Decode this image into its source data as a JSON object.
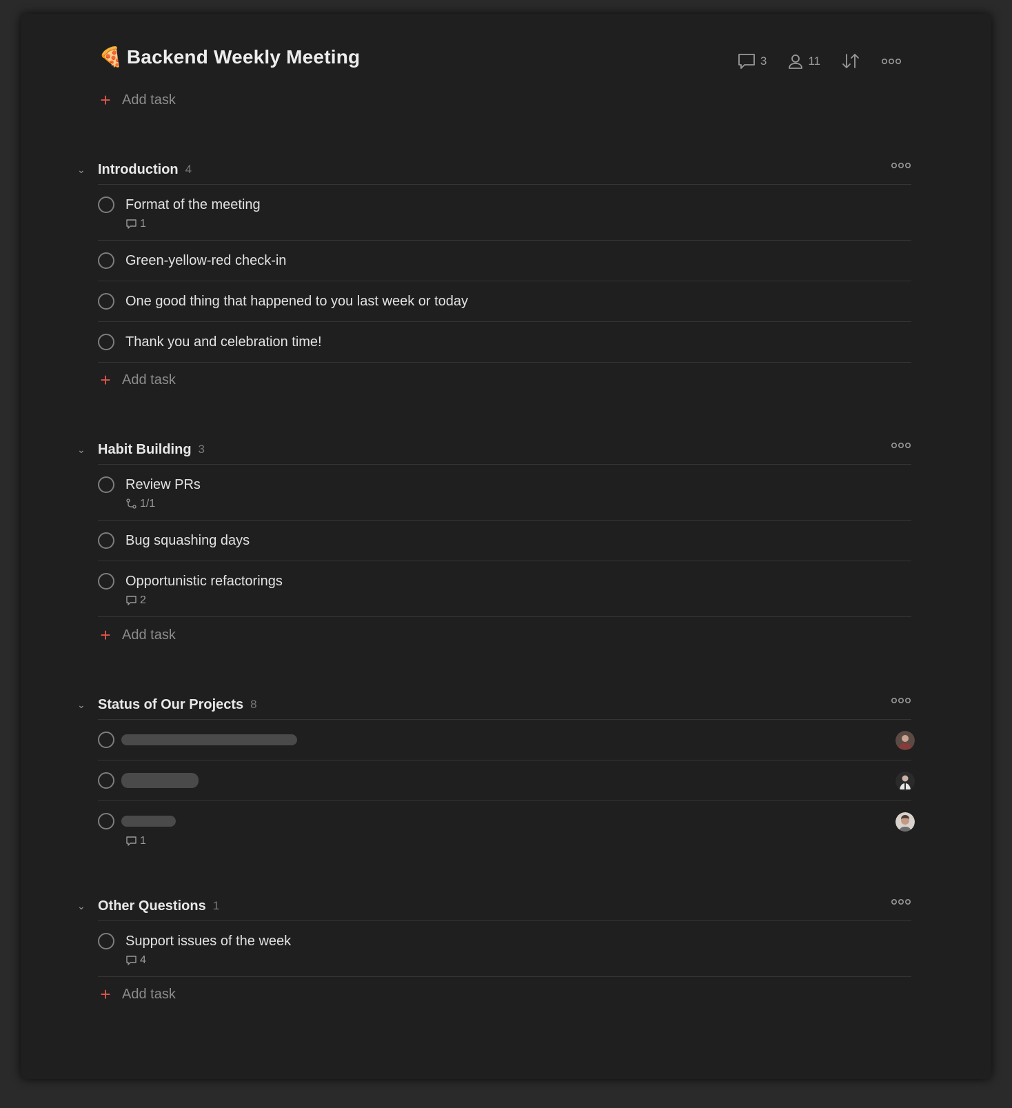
{
  "project": {
    "emoji": "🍕",
    "title": "Backend Weekly Meeting",
    "comments_count": "3",
    "members_count": "11"
  },
  "add_task_label": "Add task",
  "sections": [
    {
      "title": "Introduction",
      "count": "4",
      "tasks": [
        {
          "text": "Format of the meeting",
          "comments": "1"
        },
        {
          "text": "Green-yellow-red check-in"
        },
        {
          "text": "One good thing that happened to you last week or today"
        },
        {
          "text": "Thank you and celebration time!"
        }
      ]
    },
    {
      "title": "Habit Building",
      "count": "3",
      "tasks": [
        {
          "text": "Review PRs",
          "subtasks": "1/1"
        },
        {
          "text": "Bug squashing days"
        },
        {
          "text": "Opportunistic refactorings",
          "comments": "2"
        }
      ]
    },
    {
      "title": "Status of Our Projects",
      "count": "8",
      "tasks": [
        {
          "redacted": true
        },
        {
          "redacted": true
        },
        {
          "redacted": true,
          "comments": "1"
        }
      ]
    },
    {
      "title": "Other Questions",
      "count": "1",
      "tasks": [
        {
          "text": "Support issues of the week",
          "comments": "4"
        }
      ]
    }
  ],
  "colors": {
    "background": "#1f1f1f",
    "accent_plus": "#e0554a",
    "text": "#e2e2e2",
    "muted": "#9a9a9a"
  }
}
